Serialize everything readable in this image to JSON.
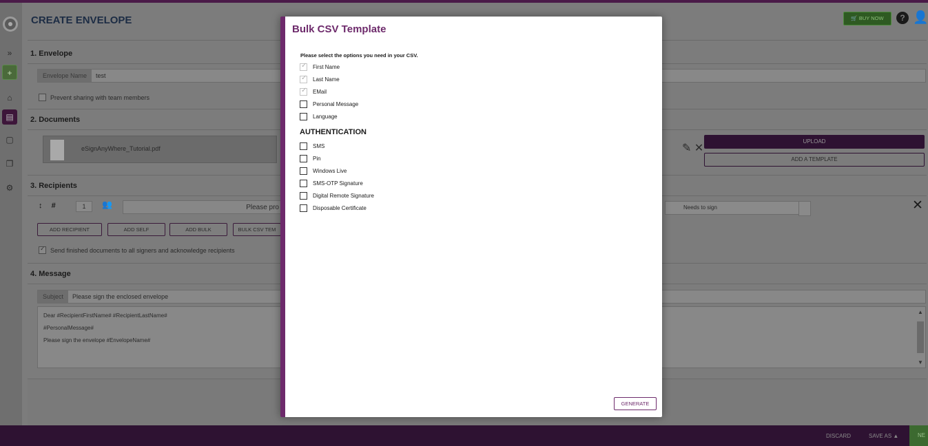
{
  "header": {
    "page_title": "CREATE ENVELOPE",
    "buy_now": "BUY NOW"
  },
  "sidebar": {
    "items": [
      {
        "icon": "logo-disc-icon"
      },
      {
        "icon": "expand-icon",
        "glyph": "⏵"
      },
      {
        "icon": "create-envelope-icon",
        "glyph": "🗎"
      },
      {
        "icon": "home-icon",
        "glyph": "⌂"
      },
      {
        "icon": "document-icon",
        "glyph": "▤"
      },
      {
        "icon": "draft-icon",
        "glyph": "▢"
      },
      {
        "icon": "copy-icon",
        "glyph": "❐"
      },
      {
        "icon": "settings-icon",
        "glyph": "⚙"
      }
    ]
  },
  "envelope": {
    "section_title": "1. Envelope",
    "name_label": "Envelope Name",
    "name_value": "test",
    "prevent_sharing": "Prevent sharing with team members"
  },
  "documents": {
    "section_title": "2. Documents",
    "file_name": "eSignAnyWhere_Tutorial.pdf",
    "upload": "UPLOAD",
    "add_template": "ADD A TEMPLATE"
  },
  "recipients": {
    "section_title": "3. Recipients",
    "order_number": "1",
    "name_hint": "Please pro",
    "action": "Needs to sign",
    "buttons": {
      "add_recipient": "ADD RECIPIENT",
      "add_self": "ADD SELF",
      "add_bulk": "ADD BULK",
      "bulk_csv": "BULK CSV TEM"
    },
    "send_finished": "Send finished documents to all signers and acknowledge recipients"
  },
  "message": {
    "section_title": "4. Message",
    "subject_label": "Subject",
    "subject_value": "Please sign the enclosed envelope",
    "body_lines": [
      "Dear #RecipientFirstName# #RecipientLastName#",
      "#PersonalMessage#",
      "Please sign the envelope #EnvelopeName#"
    ]
  },
  "footer": {
    "discard": "DISCARD",
    "save_as": "SAVE AS ▲",
    "next": "NE"
  },
  "modal": {
    "title": "Bulk CSV Template",
    "instruction": "Please select the options you need in your CSV.",
    "options": [
      {
        "label": "First Name",
        "checked": true,
        "disabled": true
      },
      {
        "label": "Last Name",
        "checked": true,
        "disabled": true
      },
      {
        "label": "EMail",
        "checked": true,
        "disabled": true
      },
      {
        "label": "Personal Message",
        "checked": false,
        "disabled": false
      },
      {
        "label": "Language",
        "checked": false,
        "disabled": false
      }
    ],
    "auth_heading": "AUTHENTICATION",
    "auth_options": [
      {
        "label": "SMS",
        "checked": false
      },
      {
        "label": "Pin",
        "checked": false
      },
      {
        "label": "Windows Live",
        "checked": false
      },
      {
        "label": "SMS-OTP Signature",
        "checked": false
      },
      {
        "label": "Digital Remote Signature",
        "checked": false
      },
      {
        "label": "Disposable Certificate",
        "checked": false
      }
    ],
    "generate": "GENERATE"
  },
  "colors": {
    "brand_purple": "#6d2a6b",
    "footer_purple": "#2e1232",
    "green": "#3c6a30"
  }
}
